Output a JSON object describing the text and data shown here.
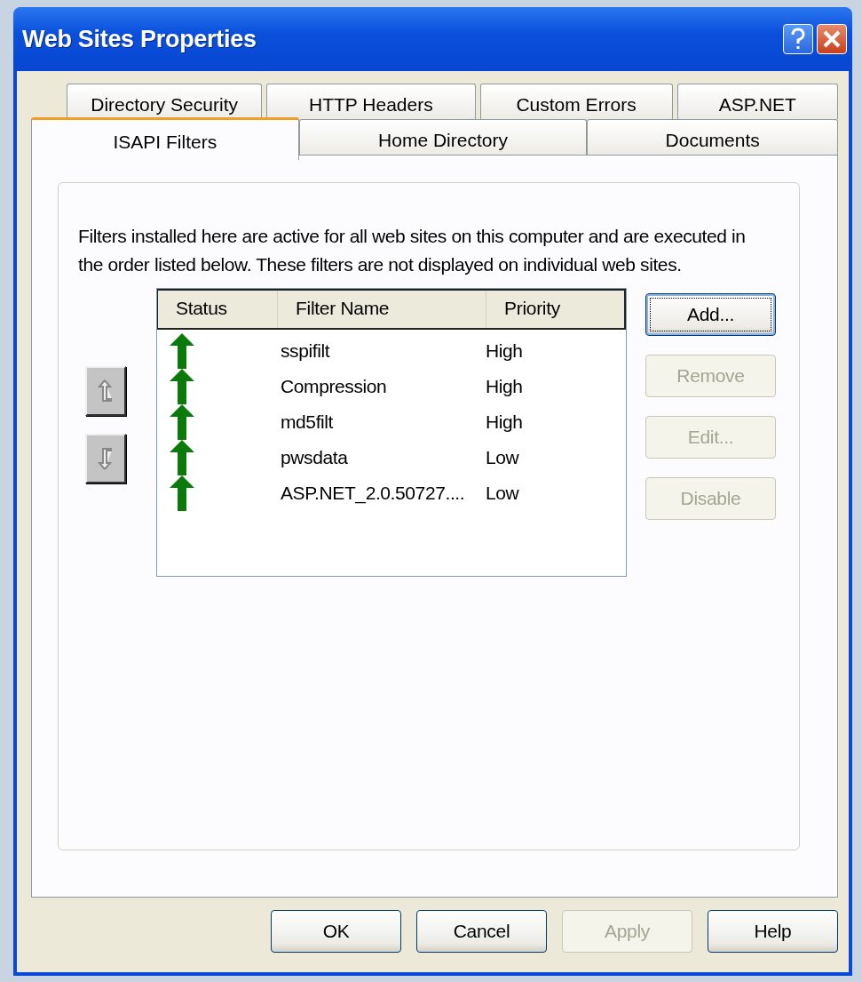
{
  "window": {
    "title": "Web Sites Properties"
  },
  "tab_rows": [
    [
      {
        "label": "Directory Security",
        "selected": false
      },
      {
        "label": "HTTP Headers",
        "selected": false
      },
      {
        "label": "Custom Errors",
        "selected": false
      },
      {
        "label": "ASP.NET",
        "selected": false
      }
    ],
    [
      {
        "label": "ISAPI Filters",
        "selected": true
      },
      {
        "label": "Home Directory",
        "selected": false
      },
      {
        "label": "Documents",
        "selected": false
      }
    ]
  ],
  "description": "Filters installed here are active for all web sites on this computer and are executed in the order listed below.  These filters are not displayed on individual web sites.",
  "move_buttons": [
    {
      "kind": "up",
      "disabled": true
    },
    {
      "kind": "down",
      "disabled": true
    }
  ],
  "filters": {
    "columns": [
      "Status",
      "Filter Name",
      "Priority"
    ],
    "rows": [
      {
        "enabled": true,
        "name": "sspifilt",
        "priority": "High"
      },
      {
        "enabled": true,
        "name": "Compression",
        "priority": "High"
      },
      {
        "enabled": true,
        "name": "md5filt",
        "priority": "High"
      },
      {
        "enabled": true,
        "name": "pwsdata",
        "priority": "Low"
      },
      {
        "enabled": true,
        "name": "ASP.NET_2.0.50727....",
        "priority": "Low"
      }
    ]
  },
  "side_buttons": [
    {
      "label": "Add...",
      "disabled": false,
      "focused": true
    },
    {
      "label": "Remove",
      "disabled": true,
      "focused": false
    },
    {
      "label": "Edit...",
      "disabled": true,
      "focused": false
    },
    {
      "label": "Disable",
      "disabled": true,
      "focused": false
    }
  ],
  "footer_buttons": [
    {
      "label": "OK",
      "disabled": false
    },
    {
      "label": "Cancel",
      "disabled": false
    },
    {
      "label": "Apply",
      "disabled": true
    },
    {
      "label": "Help",
      "disabled": false
    }
  ]
}
